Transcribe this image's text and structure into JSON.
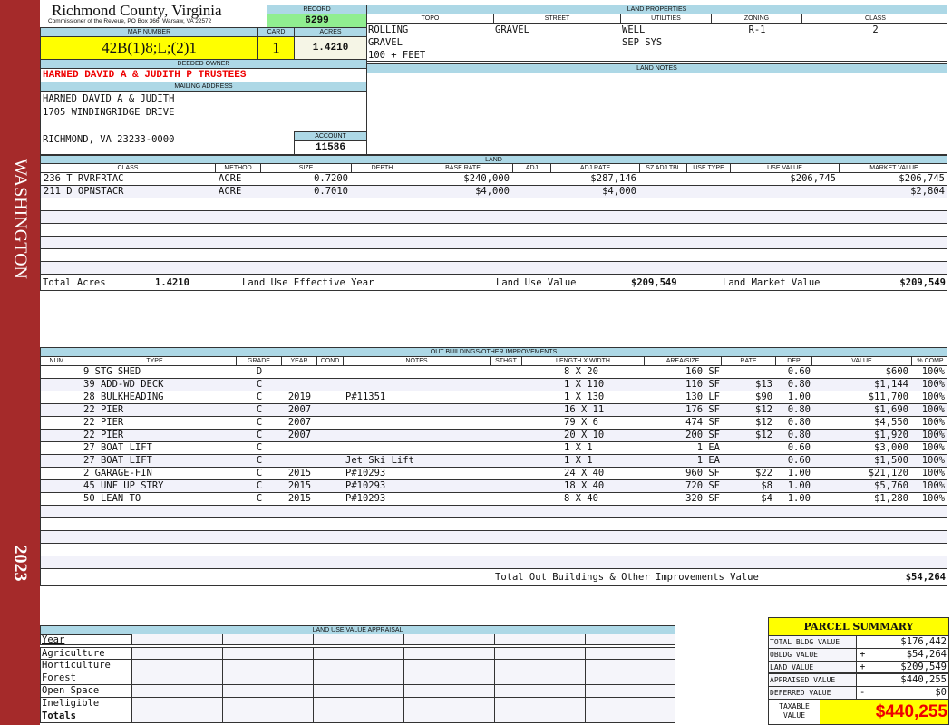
{
  "sidebar": {
    "name": "WASHINGTON",
    "year": "2023"
  },
  "header": {
    "title": "Richmond County, Virginia",
    "subtitle": "Commissioner of the Reveue, PO Box 366, Warsaw, VA 22572",
    "record_label": "RECORD",
    "record": "6299"
  },
  "parcel": {
    "map_label": "MAP NUMBER",
    "map": "42B(1)8;L;(2)1",
    "card_label": "CARD",
    "card": "1",
    "acres_label": "ACRES",
    "acres": "1.4210"
  },
  "owner": {
    "label": "DEEDED OWNER",
    "name": "HARNED DAVID A & JUDITH P TRUSTEES",
    "mail_label": "MAILING ADDRESS",
    "addr1": "HARNED DAVID A & JUDITH",
    "addr2": "1705 WINDINGRIDGE DRIVE",
    "addr3": "RICHMOND, VA 23233-0000",
    "account_label": "ACCOUNT",
    "account": "11586"
  },
  "land_props": {
    "label": "LAND PROPERTIES",
    "cols": [
      "TOPO",
      "STREET",
      "UTILITIES",
      "ZONING",
      "CLASS"
    ],
    "topo": [
      "ROLLING",
      "GRAVEL",
      "100 + FEET"
    ],
    "street": "GRAVEL",
    "utilities": [
      "WELL",
      "SEP SYS"
    ],
    "zoning": "R-1",
    "class": "2",
    "notes_label": "LAND NOTES"
  },
  "land": {
    "label": "LAND",
    "cols": [
      "CLASS",
      "METHOD",
      "SIZE",
      "DEPTH",
      "BASE RATE",
      "ADJ",
      "ADJ RATE",
      "SZ ADJ TBL",
      "USE TYPE",
      "USE VALUE",
      "MARKET VALUE"
    ],
    "rows": [
      [
        "236 T RVRFRTAC",
        "ACRE",
        "0.7200",
        "",
        "$240,000",
        "",
        "$287,146",
        "",
        "",
        "$206,745",
        "$206,745"
      ],
      [
        "211 D OPNSTACR",
        "ACRE",
        "0.7010",
        "",
        "$4,000",
        "",
        "$4,000",
        "",
        "",
        "",
        "$2,804"
      ]
    ],
    "total_acres_label": "Total Acres",
    "total_acres": "1.4210",
    "effective_year_label": "Land Use Effective Year",
    "use_value_label": "Land Use Value",
    "use_value": "$209,549",
    "market_value_label": "Land Market Value",
    "market_value": "$209,549"
  },
  "outbuildings": {
    "label": "OUT BUILDINGS/OTHER IMPROVEMENTS",
    "cols": [
      "NUM",
      "TYPE",
      "GRADE",
      "YEAR",
      "COND",
      "NOTES",
      "STHGT",
      "LENGTH X WIDTH",
      "AREA/SIZE",
      "RATE",
      "DEP",
      "VALUE",
      "% COMP"
    ],
    "rows": [
      [
        "9 STG SHED",
        "D",
        "",
        "",
        "",
        "8 X 20",
        "160 SF",
        "",
        "0.60",
        "$600",
        "100%"
      ],
      [
        "39 ADD-WD DECK",
        "C",
        "",
        "",
        "",
        "1 X 110",
        "110 SF",
        "$13",
        "0.80",
        "$1,144",
        "100%"
      ],
      [
        "28 BULKHEADING",
        "C",
        "2019",
        "",
        "P#11351",
        "1 X 130",
        "130 LF",
        "$90",
        "1.00",
        "$11,700",
        "100%"
      ],
      [
        "22 PIER",
        "C",
        "2007",
        "",
        "",
        "16 X 11",
        "176 SF",
        "$12",
        "0.80",
        "$1,690",
        "100%"
      ],
      [
        "22 PIER",
        "C",
        "2007",
        "",
        "",
        "79 X 6",
        "474 SF",
        "$12",
        "0.80",
        "$4,550",
        "100%"
      ],
      [
        "22 PIER",
        "C",
        "2007",
        "",
        "",
        "20 X 10",
        "200 SF",
        "$12",
        "0.80",
        "$1,920",
        "100%"
      ],
      [
        "27 BOAT LIFT",
        "C",
        "",
        "",
        "",
        "1 X 1",
        "1 EA",
        "",
        "0.60",
        "$3,000",
        "100%"
      ],
      [
        "27 BOAT LIFT",
        "C",
        "",
        "",
        "Jet Ski Lift",
        "1 X 1",
        "1 EA",
        "",
        "0.60",
        "$1,500",
        "100%"
      ],
      [
        "2 GARAGE-FIN",
        "C",
        "2015",
        "",
        "P#10293",
        "24 X 40",
        "960 SF",
        "$22",
        "1.00",
        "$21,120",
        "100%"
      ],
      [
        "45 UNF UP STRY",
        "C",
        "2015",
        "",
        "P#10293",
        "18 X 40",
        "720 SF",
        "$8",
        "1.00",
        "$5,760",
        "100%"
      ],
      [
        "50 LEAN TO",
        "C",
        "2015",
        "",
        "P#10293",
        "8 X 40",
        "320 SF",
        "$4",
        "1.00",
        "$1,280",
        "100%"
      ]
    ],
    "total_label": "Total Out Buildings & Other Improvements Value",
    "total": "$54,264"
  },
  "luva": {
    "label": "LAND USE VALUE APPRAISAL",
    "year_label": "Year",
    "rows": [
      "Agriculture",
      "Horticulture",
      "Forest",
      "Open Space",
      "Ineligible"
    ],
    "totals_label": "Totals"
  },
  "summary": {
    "title": "PARCEL SUMMARY",
    "rows": [
      [
        "TOTAL BLDG VALUE",
        "",
        "$176,442"
      ],
      [
        "OBLDG VALUE",
        "+",
        "$54,264"
      ],
      [
        "LAND VALUE",
        "+",
        "$209,549"
      ],
      [
        "APPRAISED VALUE",
        "",
        "$440,255"
      ],
      [
        "DEFERRED VALUE",
        "-",
        "$0"
      ]
    ],
    "taxable_label": "TAXABLE VALUE",
    "taxable": "$440,255"
  }
}
